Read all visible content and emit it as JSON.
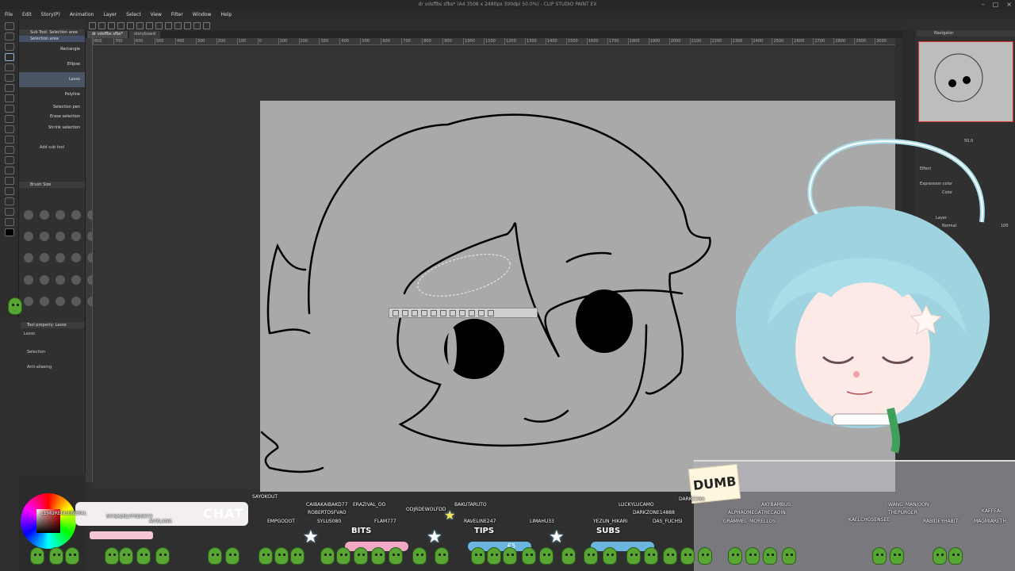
{
  "window": {
    "title": "dr vdsffbs sfbs* (A4 3508 x 2480px 300dpi 50.0%) - CLIP STUDIO PAINT EX"
  },
  "menu": [
    "File",
    "Edit",
    "Story(P)",
    "Animation",
    "Layer",
    "Select",
    "View",
    "Filter",
    "Window",
    "Help"
  ],
  "doc_tabs": [
    "dr vdsffbs sfbs*",
    "storyboard"
  ],
  "ruler_ticks": [
    "800",
    "700",
    "600",
    "500",
    "400",
    "300",
    "200",
    "100",
    "0",
    "100",
    "200",
    "300",
    "400",
    "500",
    "600",
    "700",
    "800",
    "900",
    "1000",
    "1100",
    "1200",
    "1300",
    "1400",
    "1500",
    "1600",
    "1700",
    "1800",
    "1900",
    "2000",
    "2100",
    "2200",
    "2300",
    "2400",
    "2500",
    "2600",
    "2700",
    "2800",
    "2900",
    "3000"
  ],
  "sub_tool": {
    "header": "Sub Tool: Selection area",
    "tab": "Selection area",
    "items": [
      "Rectangle",
      "Ellipse",
      "Lasso",
      "Polyline",
      "Selection pen",
      "Erase selection",
      "Shrink selection"
    ],
    "add_label": "Add sub tool"
  },
  "brush_size": {
    "header": "Brush Size"
  },
  "tool_property": {
    "header": "Tool property: Lasso",
    "tool_name": "Lasso",
    "rows": [
      "Selection",
      "Anti-aliasing"
    ]
  },
  "navigator": {
    "header": "Navigator",
    "zoom": "50.0"
  },
  "layer_panel": {
    "effect_label": "Effect",
    "expression_color": "Expression color",
    "color_mode": "Color",
    "layer_tab": "Layer",
    "blend_mode": "Normal",
    "opacity": "100"
  },
  "overlay": {
    "chat_label": "CHAT",
    "bits_label": "BITS",
    "tips_label": "TIPS",
    "subs_label": "SUBS",
    "tips_amount": "€5",
    "sticky_note": "DUMB",
    "names": {
      "n1": "LEMURENGENERAL",
      "n2": "MYKAENLYFRENKY3",
      "n3": "AVOLANA",
      "n4": "SAYOKOUT",
      "n5": "CAIBAKAIBAKD77",
      "n6": "ERAZIVAL_OO",
      "n7": "ODJRDEWOLFDD",
      "n8": "BAKUTARUTO",
      "n9": "EMPGODOT",
      "n10": "ROBERTOSFVAO",
      "n11": "SYLUS080",
      "n12": "FLAM777",
      "n13": "RAVELINE247",
      "n14": "LIMAHU33",
      "n15": "LUCKYLUCAMO",
      "n16": "DARKZONE14888",
      "n17": "YEZUN_HIKARI",
      "n18": "DAS_FUCHSI",
      "n19": "AKYBAMBUS",
      "n20": "ALPHAOMEGATHECAOIN",
      "n21": "GRAMMEL_MORELLOS",
      "n22": "WANG_MANJOON",
      "n23": "THEPURGER",
      "n24": "KAELCHOSENSEE",
      "n25": "RABIDEYHABIT",
      "n26": "KAEFEAI",
      "n27": "MAGMIARETH",
      "n28": "DARKZ26A"
    }
  },
  "colors": {
    "paper": "#a9a9a9",
    "ui_bg": "#2f2f2f",
    "avatar_hair": "#a9dde8",
    "chat_pink": "#f5c6d7",
    "bar_blue": "#6ab6e0",
    "bean_green": "#58a534"
  },
  "icons": [
    "selection-tool-icon",
    "lasso-icon",
    "brush-icon",
    "eraser-icon",
    "fill-icon",
    "text-icon",
    "star-icon",
    "navigator-icon"
  ]
}
